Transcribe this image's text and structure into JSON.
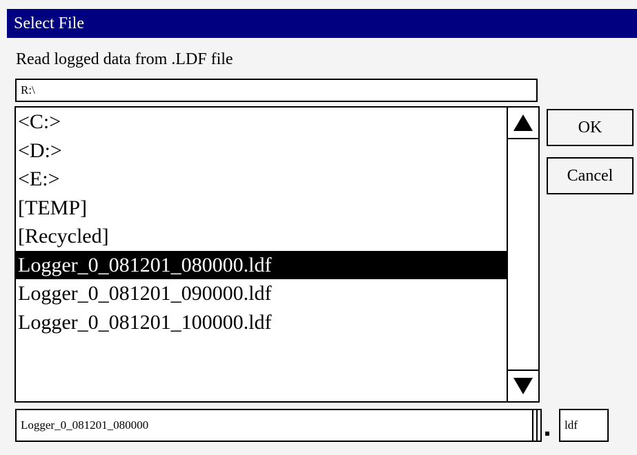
{
  "dialog": {
    "title": "Select File",
    "prompt": "Read logged data from .LDF file"
  },
  "path": {
    "value": "R:\\"
  },
  "file_list": {
    "items": [
      "<C:>",
      "<D:>",
      "<E:>",
      "[TEMP]",
      "[Recycled]",
      "Logger_0_081201_080000.ldf",
      "Logger_0_081201_090000.ldf",
      "Logger_0_081201_100000.ldf"
    ],
    "selected_item": "Logger_0_081201_080000.ldf"
  },
  "buttons": {
    "ok_label": "OK",
    "cancel_label": "Cancel"
  },
  "filename": {
    "value": "Logger_0_081201_080000"
  },
  "extension": {
    "value": "ldf"
  },
  "icons": {
    "scroll_up": "triangle-up-icon",
    "scroll_down": "triangle-down-icon"
  },
  "colors": {
    "title_bar": "#000080",
    "selection": "#000000"
  }
}
